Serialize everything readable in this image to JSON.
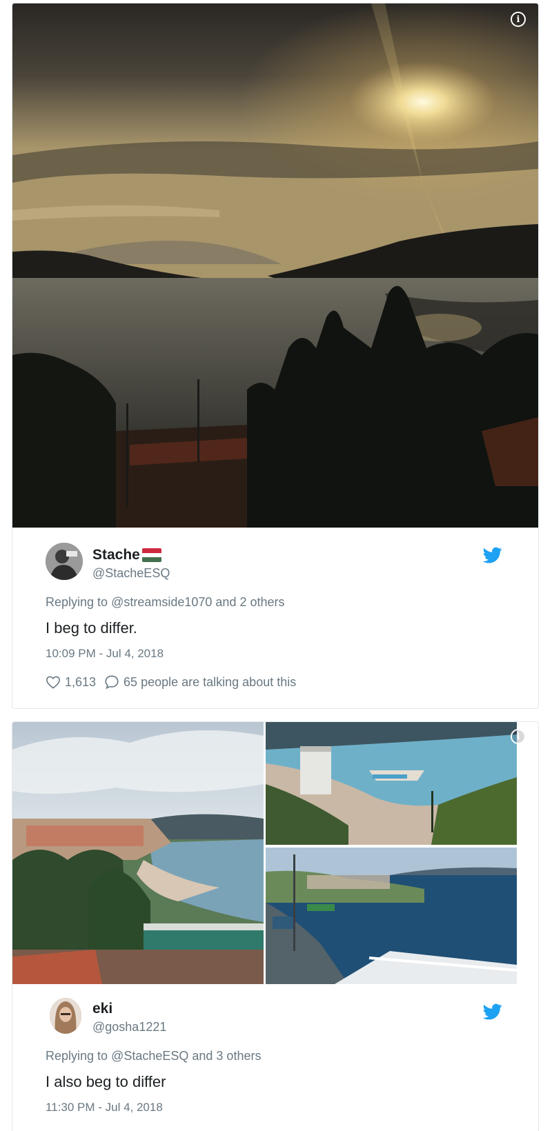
{
  "tweets": [
    {
      "author": {
        "name": "Stache",
        "handle": "@StacheESQ",
        "flag": "hungary-flag"
      },
      "reply": {
        "prefix": "Replying to ",
        "mention": "@streamside1070",
        "suffix": " and 2 others"
      },
      "text": "I beg to differ.",
      "time": "10:09 PM - Jul 4, 2018",
      "likes": "1,613",
      "talking": "65 people are talking about this",
      "info_icon": "i"
    },
    {
      "author": {
        "name": "eki",
        "handle": "@gosha1221"
      },
      "reply": {
        "prefix": "Replying to ",
        "mention": "@StacheESQ",
        "suffix": " and 3 others"
      },
      "text": "I also beg to differ",
      "time": "11:30 PM - Jul 4, 2018",
      "info_icon": "i"
    }
  ],
  "colors": {
    "twitter_blue": "#1da1f2",
    "secondary_text": "#697882",
    "border": "#e1e8ed"
  }
}
